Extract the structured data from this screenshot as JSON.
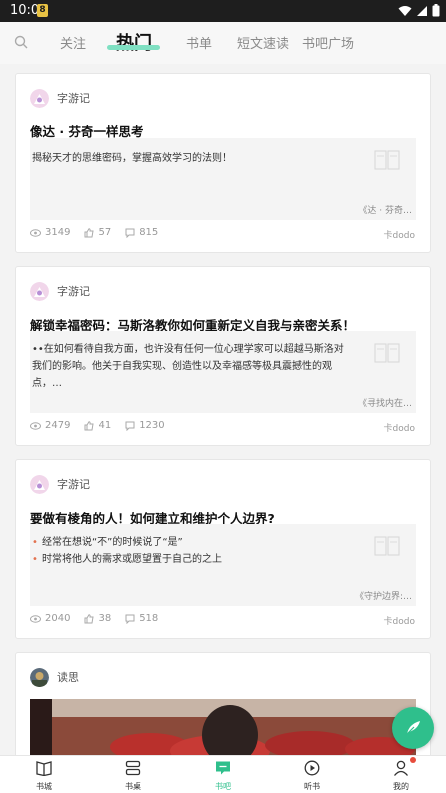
{
  "status_bar": {
    "time": "10:00",
    "notif_badge": "8"
  },
  "top_tabs": [
    {
      "label": "关注",
      "active": false
    },
    {
      "label": "热门",
      "active": true
    },
    {
      "label": "书单",
      "active": false
    },
    {
      "label": "短文速读",
      "active": false
    },
    {
      "label": "书吧广场",
      "active": false
    }
  ],
  "feed": [
    {
      "author": "字游记",
      "title": "像达 · 芬奇一样思考",
      "preview_lines": [
        "揭秘天才的思维密码，掌握高效学习的法则！"
      ],
      "book_name": "《达 · 芬奇…",
      "views": "3149",
      "likes": "57",
      "comments": "815",
      "source": "卡dodo"
    },
    {
      "author": "字游记",
      "title": "解锁幸福密码：马斯洛教你如何重新定义自我与亲密关系！",
      "preview_lines": [
        "••在如何看待自我方面，也许没有任何一位心理学家可以超越马斯洛对我们的影响。他关于自我实现、创造性以及幸福感等极具震撼性的观点，…"
      ],
      "book_name": "《寻找内在…",
      "views": "2479",
      "likes": "41",
      "comments": "1230",
      "source": "卡dodo"
    },
    {
      "author": "字游记",
      "title": "要做有棱角的人！如何建立和维护个人边界?",
      "preview_lines": [
        "经常在想说“不”的时候说了“是”",
        "时常将他人的需求或愿望置于自己的之上"
      ],
      "book_name": "《守护边界:…",
      "views": "2040",
      "likes": "38",
      "comments": "518",
      "source": "卡dodo"
    },
    {
      "author": "读思"
    }
  ],
  "bottom_nav": [
    {
      "label": "书城",
      "icon": "book-open-icon",
      "active": false
    },
    {
      "label": "书桌",
      "icon": "desk-icon",
      "active": false
    },
    {
      "label": "书吧",
      "icon": "chat-icon",
      "active": true
    },
    {
      "label": "听书",
      "icon": "play-icon",
      "active": false
    },
    {
      "label": "我的",
      "icon": "person-icon",
      "active": false
    }
  ],
  "colors": {
    "accent": "#2fbf8c",
    "tab_underline": "#7fe0c2",
    "badge_red": "#e74c3c"
  }
}
